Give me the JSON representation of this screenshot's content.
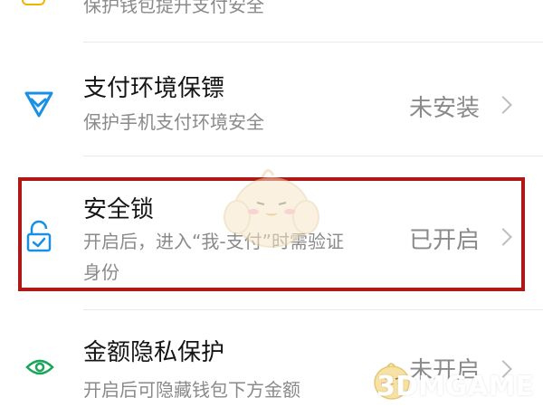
{
  "top_row": {
    "subtitle": "保护钱包提升支付安全"
  },
  "rows": [
    {
      "title": "支付环境保镖",
      "subtitle": "保护手机支付环境安全",
      "status": "未安装",
      "icon": "shield-check-icon",
      "icon_color": "#1a8fe6"
    },
    {
      "title": "安全锁",
      "subtitle_line1": "开启后，进入“我-支付”时需验证",
      "subtitle_line2": "身份",
      "status": "已开启",
      "icon": "lock-icon",
      "icon_color": "#1a8fe6"
    },
    {
      "title": "金额隐私保护",
      "subtitle": "开启后可隐藏钱包下方金额",
      "status": "未开启",
      "icon": "eye-icon",
      "icon_color": "#1aa55a"
    }
  ],
  "watermark": {
    "text": "3DMGAME"
  },
  "colors": {
    "highlight": "#b01818",
    "muted": "#8a8a8a",
    "divider": "#e9e9e9"
  }
}
